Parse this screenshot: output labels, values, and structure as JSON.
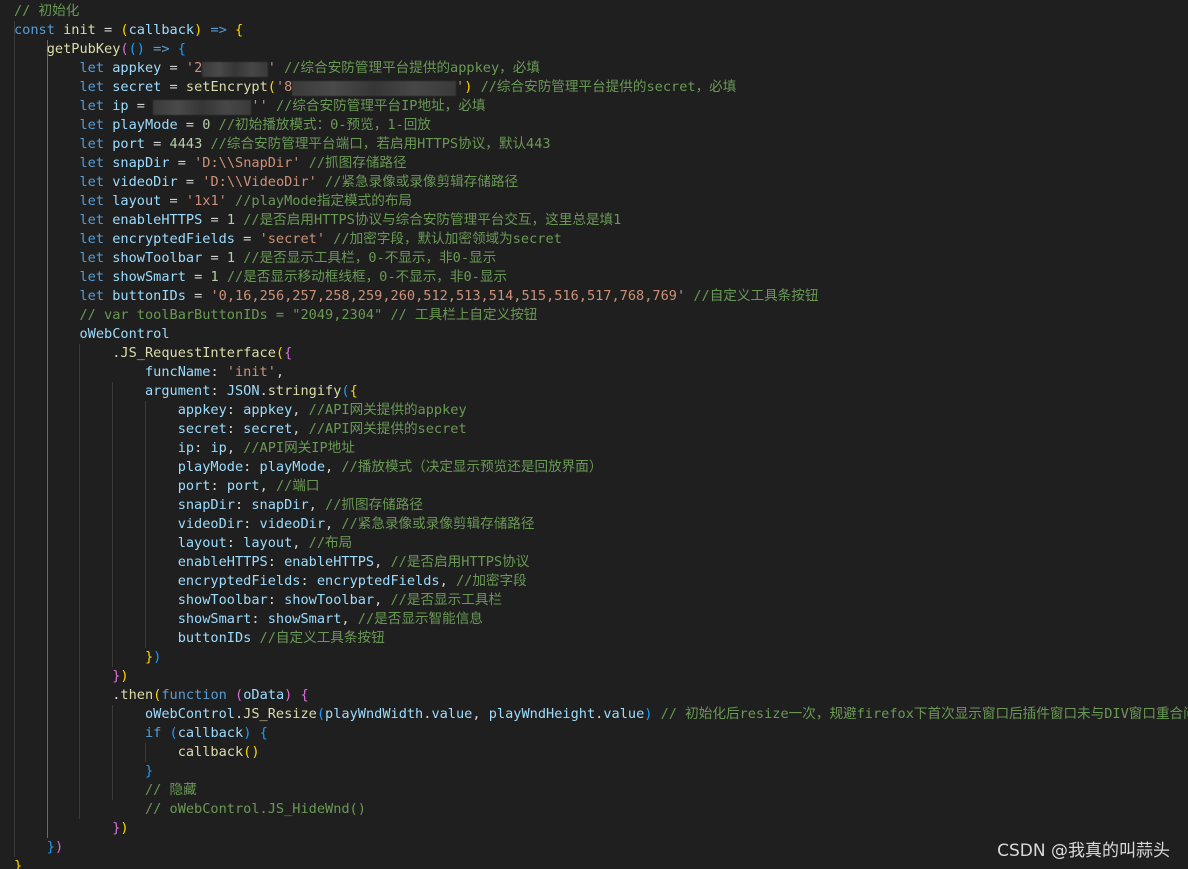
{
  "code": {
    "lines": [
      [
        [
          "cm",
          "// 初始化"
        ]
      ],
      [
        [
          "kw",
          "const"
        ],
        [
          "pn",
          " "
        ],
        [
          "fn",
          "init"
        ],
        [
          "pn",
          " = "
        ],
        [
          "b1",
          "("
        ],
        [
          "var",
          "callback"
        ],
        [
          "b1",
          ")"
        ],
        [
          "pn",
          " "
        ],
        [
          "kw",
          "=>"
        ],
        [
          "pn",
          " "
        ],
        [
          "b1",
          "{"
        ]
      ],
      [
        [
          "pn",
          "    "
        ],
        [
          "fn",
          "getPubKey"
        ],
        [
          "b2",
          "("
        ],
        [
          "b3",
          "("
        ],
        [
          "b3",
          ")"
        ],
        [
          "pn",
          " "
        ],
        [
          "kw",
          "=>"
        ],
        [
          "pn",
          " "
        ],
        [
          "b3",
          "{"
        ]
      ],
      [
        [
          "pn",
          "        "
        ],
        [
          "kw",
          "let"
        ],
        [
          "pn",
          " "
        ],
        [
          "var",
          "appkey"
        ],
        [
          "pn",
          " = "
        ],
        [
          "str",
          "'2"
        ],
        [
          "mask",
          "        "
        ],
        [
          "str",
          "'"
        ],
        [
          "pn",
          " "
        ],
        [
          "cm",
          "//综合安防管理平台提供的appkey，必填"
        ]
      ],
      [
        [
          "pn",
          "        "
        ],
        [
          "kw",
          "let"
        ],
        [
          "pn",
          " "
        ],
        [
          "var",
          "secret"
        ],
        [
          "pn",
          " = "
        ],
        [
          "fn",
          "setEncrypt"
        ],
        [
          "b1",
          "("
        ],
        [
          "str",
          "'8"
        ],
        [
          "mask",
          "                    "
        ],
        [
          "str",
          "'"
        ],
        [
          "b1",
          ")"
        ],
        [
          "pn",
          " "
        ],
        [
          "cm",
          "//综合安防管理平台提供的secret，必填"
        ]
      ],
      [
        [
          "pn",
          "        "
        ],
        [
          "kw",
          "let"
        ],
        [
          "pn",
          " "
        ],
        [
          "var",
          "ip"
        ],
        [
          "pn",
          " = "
        ],
        [
          "mask",
          "            "
        ],
        [
          "str",
          "''"
        ],
        [
          "pn",
          " "
        ],
        [
          "cm",
          "//综合安防管理平台IP地址，必填"
        ]
      ],
      [
        [
          "pn",
          "        "
        ],
        [
          "kw",
          "let"
        ],
        [
          "pn",
          " "
        ],
        [
          "var",
          "playMode"
        ],
        [
          "pn",
          " = "
        ],
        [
          "num",
          "0"
        ],
        [
          "pn",
          " "
        ],
        [
          "cm",
          "//初始播放模式：0-预览，1-回放"
        ]
      ],
      [
        [
          "pn",
          "        "
        ],
        [
          "kw",
          "let"
        ],
        [
          "pn",
          " "
        ],
        [
          "var",
          "port"
        ],
        [
          "pn",
          " = "
        ],
        [
          "num",
          "4443"
        ],
        [
          "pn",
          " "
        ],
        [
          "cm",
          "//综合安防管理平台端口，若启用HTTPS协议，默认443"
        ]
      ],
      [
        [
          "pn",
          "        "
        ],
        [
          "kw",
          "let"
        ],
        [
          "pn",
          " "
        ],
        [
          "var",
          "snapDir"
        ],
        [
          "pn",
          " = "
        ],
        [
          "str",
          "'D:\\\\SnapDir'"
        ],
        [
          "pn",
          " "
        ],
        [
          "cm",
          "//抓图存储路径"
        ]
      ],
      [
        [
          "pn",
          "        "
        ],
        [
          "kw",
          "let"
        ],
        [
          "pn",
          " "
        ],
        [
          "var",
          "videoDir"
        ],
        [
          "pn",
          " = "
        ],
        [
          "str",
          "'D:\\\\VideoDir'"
        ],
        [
          "pn",
          " "
        ],
        [
          "cm",
          "//紧急录像或录像剪辑存储路径"
        ]
      ],
      [
        [
          "pn",
          "        "
        ],
        [
          "kw",
          "let"
        ],
        [
          "pn",
          " "
        ],
        [
          "var",
          "layout"
        ],
        [
          "pn",
          " = "
        ],
        [
          "str",
          "'1x1'"
        ],
        [
          "pn",
          " "
        ],
        [
          "cm",
          "//playMode指定模式的布局"
        ]
      ],
      [
        [
          "pn",
          "        "
        ],
        [
          "kw",
          "let"
        ],
        [
          "pn",
          " "
        ],
        [
          "var",
          "enableHTTPS"
        ],
        [
          "pn",
          " = "
        ],
        [
          "num",
          "1"
        ],
        [
          "pn",
          " "
        ],
        [
          "cm",
          "//是否启用HTTPS协议与综合安防管理平台交互，这里总是填1"
        ]
      ],
      [
        [
          "pn",
          "        "
        ],
        [
          "kw",
          "let"
        ],
        [
          "pn",
          " "
        ],
        [
          "var",
          "encryptedFields"
        ],
        [
          "pn",
          " = "
        ],
        [
          "str",
          "'secret'"
        ],
        [
          "pn",
          " "
        ],
        [
          "cm",
          "//加密字段，默认加密领域为secret"
        ]
      ],
      [
        [
          "pn",
          "        "
        ],
        [
          "kw",
          "let"
        ],
        [
          "pn",
          " "
        ],
        [
          "var",
          "showToolbar"
        ],
        [
          "pn",
          " = "
        ],
        [
          "num",
          "1"
        ],
        [
          "pn",
          " "
        ],
        [
          "cm",
          "//是否显示工具栏，0-不显示，非0-显示"
        ]
      ],
      [
        [
          "pn",
          "        "
        ],
        [
          "kw",
          "let"
        ],
        [
          "pn",
          " "
        ],
        [
          "var",
          "showSmart"
        ],
        [
          "pn",
          " = "
        ],
        [
          "num",
          "1"
        ],
        [
          "pn",
          " "
        ],
        [
          "cm",
          "//是否显示移动框线框，0-不显示，非0-显示"
        ]
      ],
      [
        [
          "pn",
          "        "
        ],
        [
          "kw",
          "let"
        ],
        [
          "pn",
          " "
        ],
        [
          "var",
          "buttonIDs"
        ],
        [
          "pn",
          " = "
        ],
        [
          "str",
          "'0,16,256,257,258,259,260,512,513,514,515,516,517,768,769'"
        ],
        [
          "pn",
          " "
        ],
        [
          "cm",
          "//自定义工具条按钮"
        ]
      ],
      [
        [
          "pn",
          "        "
        ],
        [
          "cm",
          "// var toolBarButtonIDs = \"2049,2304\" // 工具栏上自定义按钮"
        ]
      ],
      [
        [
          "pn",
          "        "
        ],
        [
          "var",
          "oWebControl"
        ]
      ],
      [
        [
          "pn",
          "            ."
        ],
        [
          "fn",
          "JS_RequestInterface"
        ],
        [
          "b1",
          "("
        ],
        [
          "b2",
          "{"
        ]
      ],
      [
        [
          "pn",
          "                "
        ],
        [
          "var",
          "funcName"
        ],
        [
          "pn",
          ": "
        ],
        [
          "str",
          "'init'"
        ],
        [
          "pn",
          ","
        ]
      ],
      [
        [
          "pn",
          "                "
        ],
        [
          "var",
          "argument"
        ],
        [
          "pn",
          ": "
        ],
        [
          "var",
          "JSON"
        ],
        [
          "pn",
          "."
        ],
        [
          "fn",
          "stringify"
        ],
        [
          "b3",
          "("
        ],
        [
          "b1",
          "{"
        ]
      ],
      [
        [
          "pn",
          "                    "
        ],
        [
          "var",
          "appkey"
        ],
        [
          "pn",
          ": "
        ],
        [
          "var",
          "appkey"
        ],
        [
          "pn",
          ", "
        ],
        [
          "cm",
          "//API网关提供的appkey"
        ]
      ],
      [
        [
          "pn",
          "                    "
        ],
        [
          "var",
          "secret"
        ],
        [
          "pn",
          ": "
        ],
        [
          "var",
          "secret"
        ],
        [
          "pn",
          ", "
        ],
        [
          "cm",
          "//API网关提供的secret"
        ]
      ],
      [
        [
          "pn",
          "                    "
        ],
        [
          "var",
          "ip"
        ],
        [
          "pn",
          ": "
        ],
        [
          "var",
          "ip"
        ],
        [
          "pn",
          ", "
        ],
        [
          "cm",
          "//API网关IP地址"
        ]
      ],
      [
        [
          "pn",
          "                    "
        ],
        [
          "var",
          "playMode"
        ],
        [
          "pn",
          ": "
        ],
        [
          "var",
          "playMode"
        ],
        [
          "pn",
          ", "
        ],
        [
          "cm",
          "//播放模式（决定显示预览还是回放界面）"
        ]
      ],
      [
        [
          "pn",
          "                    "
        ],
        [
          "var",
          "port"
        ],
        [
          "pn",
          ": "
        ],
        [
          "var",
          "port"
        ],
        [
          "pn",
          ", "
        ],
        [
          "cm",
          "//端口"
        ]
      ],
      [
        [
          "pn",
          "                    "
        ],
        [
          "var",
          "snapDir"
        ],
        [
          "pn",
          ": "
        ],
        [
          "var",
          "snapDir"
        ],
        [
          "pn",
          ", "
        ],
        [
          "cm",
          "//抓图存储路径"
        ]
      ],
      [
        [
          "pn",
          "                    "
        ],
        [
          "var",
          "videoDir"
        ],
        [
          "pn",
          ": "
        ],
        [
          "var",
          "videoDir"
        ],
        [
          "pn",
          ", "
        ],
        [
          "cm",
          "//紧急录像或录像剪辑存储路径"
        ]
      ],
      [
        [
          "pn",
          "                    "
        ],
        [
          "var",
          "layout"
        ],
        [
          "pn",
          ": "
        ],
        [
          "var",
          "layout"
        ],
        [
          "pn",
          ", "
        ],
        [
          "cm",
          "//布局"
        ]
      ],
      [
        [
          "pn",
          "                    "
        ],
        [
          "var",
          "enableHTTPS"
        ],
        [
          "pn",
          ": "
        ],
        [
          "var",
          "enableHTTPS"
        ],
        [
          "pn",
          ", "
        ],
        [
          "cm",
          "//是否启用HTTPS协议"
        ]
      ],
      [
        [
          "pn",
          "                    "
        ],
        [
          "var",
          "encryptedFields"
        ],
        [
          "pn",
          ": "
        ],
        [
          "var",
          "encryptedFields"
        ],
        [
          "pn",
          ", "
        ],
        [
          "cm",
          "//加密字段"
        ]
      ],
      [
        [
          "pn",
          "                    "
        ],
        [
          "var",
          "showToolbar"
        ],
        [
          "pn",
          ": "
        ],
        [
          "var",
          "showToolbar"
        ],
        [
          "pn",
          ", "
        ],
        [
          "cm",
          "//是否显示工具栏"
        ]
      ],
      [
        [
          "pn",
          "                    "
        ],
        [
          "var",
          "showSmart"
        ],
        [
          "pn",
          ": "
        ],
        [
          "var",
          "showSmart"
        ],
        [
          "pn",
          ", "
        ],
        [
          "cm",
          "//是否显示智能信息"
        ]
      ],
      [
        [
          "pn",
          "                    "
        ],
        [
          "var",
          "buttonIDs"
        ],
        [
          "pn",
          " "
        ],
        [
          "cm",
          "//自定义工具条按钮"
        ]
      ],
      [
        [
          "pn",
          "                "
        ],
        [
          "b1",
          "}"
        ],
        [
          "b3",
          ")"
        ]
      ],
      [
        [
          "pn",
          "            "
        ],
        [
          "b2",
          "}"
        ],
        [
          "b1",
          ")"
        ]
      ],
      [
        [
          "pn",
          "            ."
        ],
        [
          "fn",
          "then"
        ],
        [
          "b1",
          "("
        ],
        [
          "kw",
          "function"
        ],
        [
          "pn",
          " "
        ],
        [
          "b2",
          "("
        ],
        [
          "var",
          "oData"
        ],
        [
          "b2",
          ")"
        ],
        [
          "pn",
          " "
        ],
        [
          "b2",
          "{"
        ]
      ],
      [
        [
          "pn",
          "                "
        ],
        [
          "var",
          "oWebControl"
        ],
        [
          "pn",
          "."
        ],
        [
          "fn",
          "JS_Resize"
        ],
        [
          "b3",
          "("
        ],
        [
          "var",
          "playWndWidth"
        ],
        [
          "pn",
          "."
        ],
        [
          "var",
          "value"
        ],
        [
          "pn",
          ", "
        ],
        [
          "var",
          "playWndHeight"
        ],
        [
          "pn",
          "."
        ],
        [
          "var",
          "value"
        ],
        [
          "b3",
          ")"
        ],
        [
          "pn",
          " "
        ],
        [
          "cm",
          "// 初始化后resize一次，规避firefox下首次显示窗口后插件窗口未与DIV窗口重合问题"
        ]
      ],
      [
        [
          "pn",
          "                "
        ],
        [
          "kw",
          "if"
        ],
        [
          "pn",
          " "
        ],
        [
          "b3",
          "("
        ],
        [
          "var",
          "callback"
        ],
        [
          "b3",
          ")"
        ],
        [
          "pn",
          " "
        ],
        [
          "b3",
          "{"
        ]
      ],
      [
        [
          "pn",
          "                    "
        ],
        [
          "fn",
          "callback"
        ],
        [
          "b1",
          "("
        ],
        [
          "b1",
          ")"
        ]
      ],
      [
        [
          "pn",
          "                "
        ],
        [
          "b3",
          "}"
        ]
      ],
      [
        [
          "pn",
          "                "
        ],
        [
          "cm",
          "// 隐藏"
        ]
      ],
      [
        [
          "pn",
          "                "
        ],
        [
          "cm",
          "// oWebControl.JS_HideWnd()"
        ]
      ],
      [
        [
          "pn",
          "            "
        ],
        [
          "b2",
          "}"
        ],
        [
          "b1",
          ")"
        ]
      ],
      [
        [
          "pn",
          "    "
        ],
        [
          "b3",
          "}"
        ],
        [
          "b2",
          ")"
        ]
      ],
      [
        [
          "b1",
          "}"
        ]
      ]
    ]
  },
  "watermark": "CSDN @我真的叫蒜头"
}
